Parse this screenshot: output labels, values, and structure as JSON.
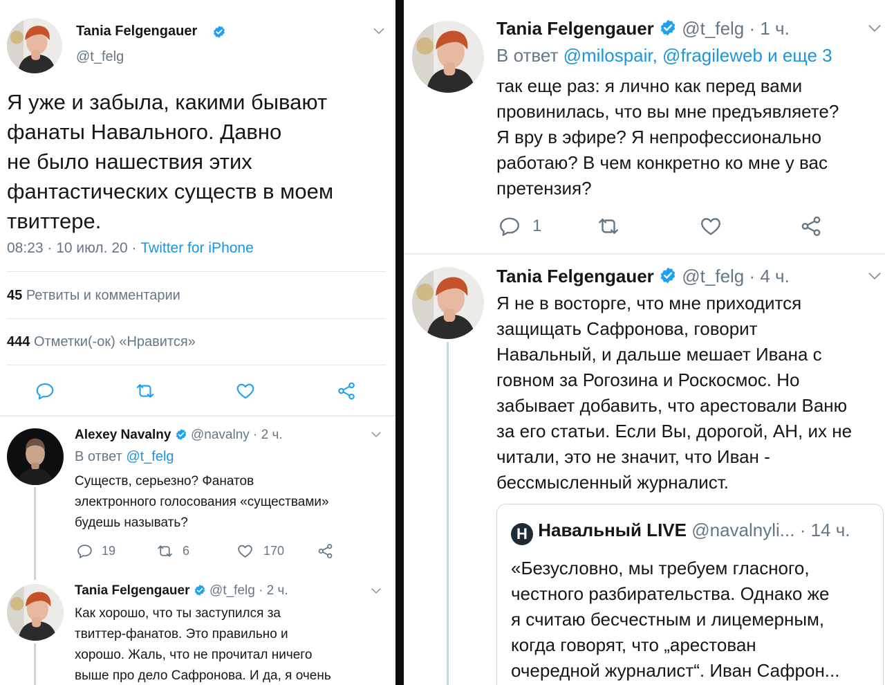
{
  "left": {
    "main_tweet": {
      "author": "Tania Felgengauer",
      "handle": "@t_felg",
      "text": "Я уже и забыла, какими бывают\nфанаты Навального. Давно\nне было нашествия этих\nфантастических существ в моем\nтвиттере.",
      "time": "08:23 · 10 июл. 20 · ",
      "source": "Twitter for iPhone",
      "retweets_count": "45",
      "retweets_label": "Ретвиты и комментарии",
      "likes_count": "444",
      "likes_label": "Отметки(-ок) «Нравится»"
    },
    "reply1": {
      "author": "Alexey Navalny",
      "meta": "@navalny · 2 ч.",
      "reply_prefix": "В ответ ",
      "reply_to": "@t_felg",
      "text": "Существ, серьезно? Фанатов\nэлектронного голосования «существами»\nбудешь называть?",
      "replies": "19",
      "retweets": "6",
      "likes": "170"
    },
    "reply2": {
      "author": "Tania Felgengauer",
      "meta": "@t_felg · 2 ч.",
      "text": "Как хорошо, что ты заступился за\nтвиттер-фанатов. Это правильно и\nхорошо. Жаль, что не прочитал ничего\nвыше про дело Сафронова. И да, я очень"
    }
  },
  "right": {
    "tweet1": {
      "author": "Tania Felgengauer",
      "meta": "@t_felg · 1 ч.",
      "reply_prefix": "В ответ ",
      "reply_to": "@milospair, @fragileweb и еще 3",
      "text": "так еще раз: я лично как перед вами\nпровинилась, что вы мне предъявляете?\nЯ вру в эфире? Я непрофессионально\nработаю? В чем конкретно ко мне у вас\nпретензия?",
      "replies": "1"
    },
    "tweet2": {
      "author": "Tania Felgengauer",
      "meta": "@t_felg · 4 ч.",
      "text": "Я не в восторге, что мне приходится\nзащищать Сафронова, говорит\nНавальный, и дальше мешает Ивана с\nговном за Рогозина и Роскосмос. Но\nзабывает добавить, что арестовали Ваню\nза его статьи. Если Вы, дорогой, АН, их не\nчитали, это не значит, что Иван -\nбессмысленный журналист.",
      "quote": {
        "logo": "Н",
        "author": "Навальный LIVE",
        "handle": "@navalnyli...",
        "time": "· 14 ч.",
        "text": "«Безусловно, мы требуем гласного,\nчестного разбирательства. Однако же\nя считаю бесчестным и лицемерным,\nкогда говорят, что „арестован\nочередной журналист“. Иван Сафрон..."
      }
    }
  },
  "colors": {
    "link": "#1b95e0",
    "muted": "#657786",
    "verified": "#1da1f2",
    "divider": "#0b0b0b"
  },
  "icons": [
    "chevron-down-icon",
    "verified-badge-icon",
    "reply-icon",
    "retweet-icon",
    "like-icon",
    "share-icon"
  ]
}
